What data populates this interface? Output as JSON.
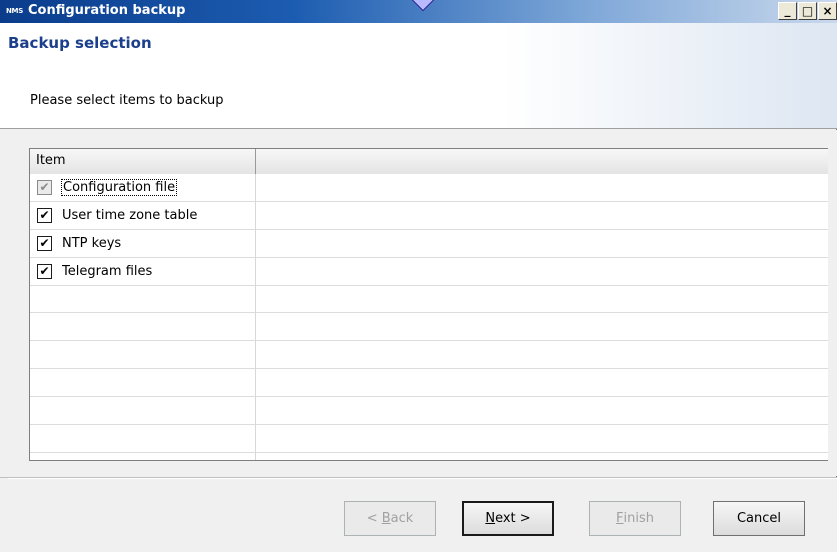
{
  "window": {
    "icon_text": "NMS",
    "title": "Configuration backup",
    "buttons": {
      "minimize": "_",
      "maximize": "□",
      "close": "×"
    }
  },
  "header": {
    "title": "Backup selection",
    "subtitle": "Please select items to backup"
  },
  "list": {
    "columns": [
      "Item",
      ""
    ],
    "items": [
      {
        "label": "Configuration file",
        "checked": true,
        "disabled": true
      },
      {
        "label": "User time zone table",
        "checked": true,
        "disabled": false
      },
      {
        "label": "NTP keys",
        "checked": true,
        "disabled": false
      },
      {
        "label": "Telegram files",
        "checked": true,
        "disabled": false
      }
    ],
    "empty_rows": 6
  },
  "footer": {
    "back": {
      "prefix": "< ",
      "underline": "B",
      "rest": "ack",
      "enabled": false
    },
    "next": {
      "underline": "N",
      "rest": "ext >",
      "enabled": true
    },
    "finish": {
      "underline": "F",
      "rest": "inish",
      "enabled": false
    },
    "cancel": {
      "label": "Cancel",
      "enabled": true
    }
  },
  "icons": {
    "check": "✔"
  }
}
